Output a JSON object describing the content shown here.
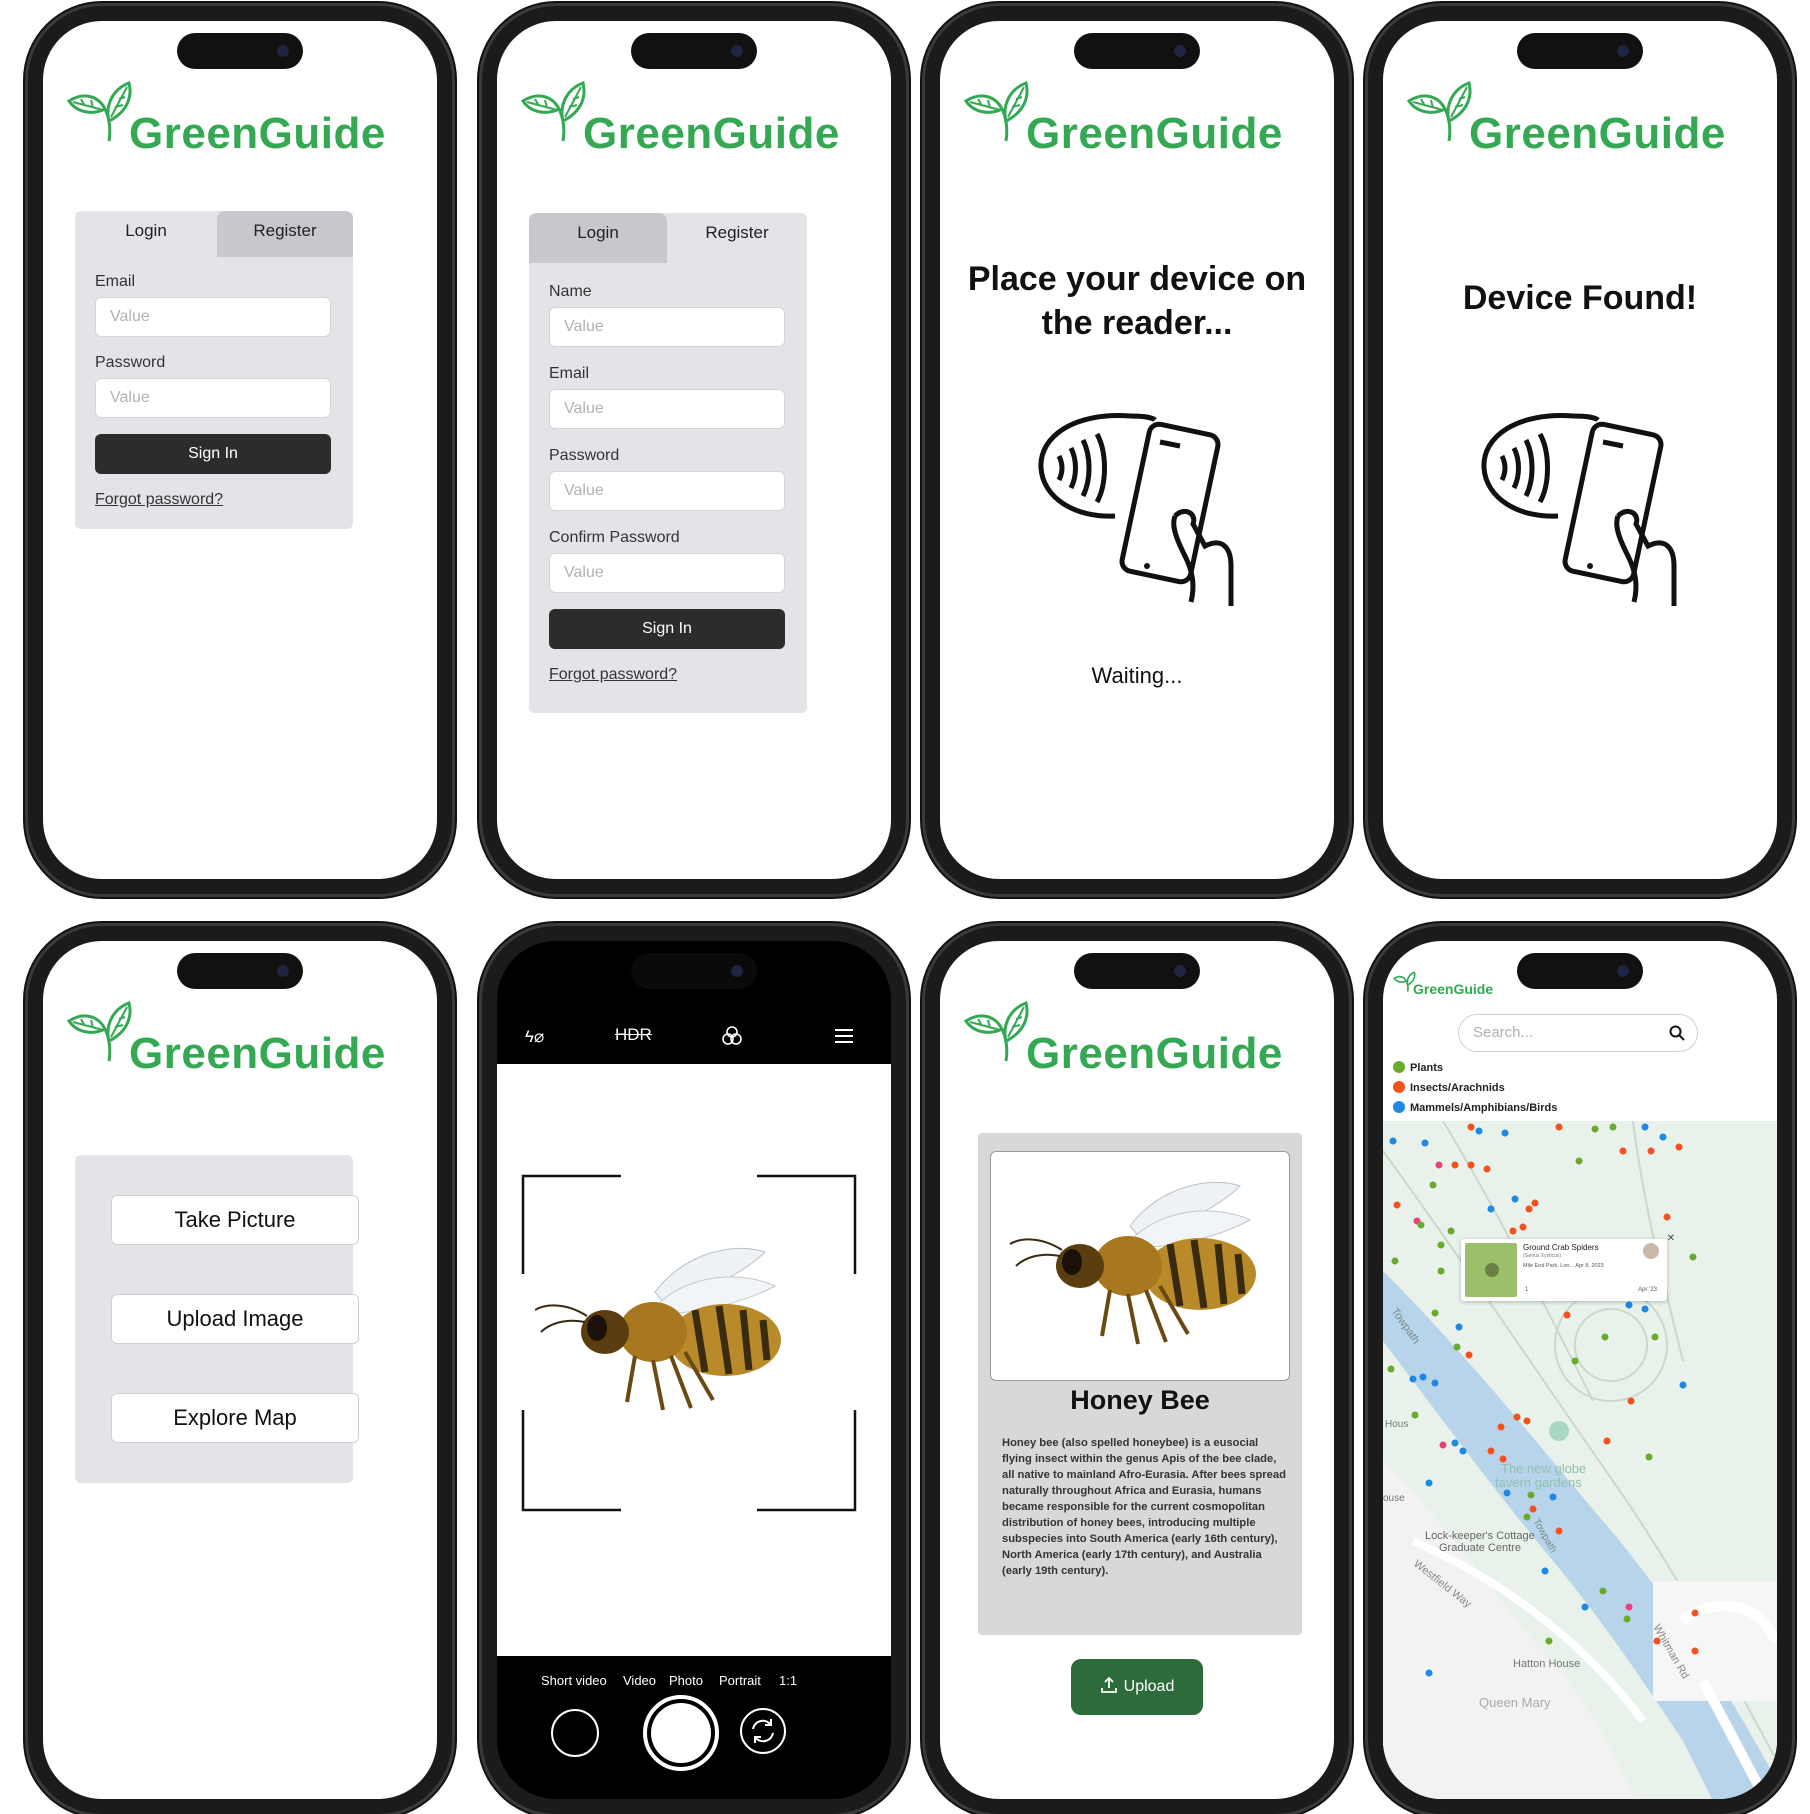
{
  "app": {
    "brand": "GreenGuide"
  },
  "login_screen": {
    "tabs": [
      "Login",
      "Register"
    ],
    "email_label": "Email",
    "email_placeholder": "Value",
    "password_label": "Password",
    "password_placeholder": "Value",
    "signin_label": "Sign In",
    "forgot_label": "Forgot password?"
  },
  "register_screen": {
    "tabs": [
      "Login",
      "Register"
    ],
    "name_label": "Name",
    "email_label": "Email",
    "password_label": "Password",
    "confirm_label": "Confirm Password",
    "placeholder": "Value",
    "signin_label": "Sign In",
    "forgot_label": "Forgot password?"
  },
  "nfc_waiting": {
    "title": "Place your device on the reader...",
    "status": "Waiting..."
  },
  "nfc_found": {
    "title": "Device Found!"
  },
  "menu_screen": {
    "take_picture": "Take Picture",
    "upload_image": "Upload Image",
    "explore_map": "Explore Map"
  },
  "camera_screen": {
    "top_icons": [
      "flash-off-icon",
      "hdr-icon",
      "filters-icon",
      "menu-icon"
    ],
    "hdr_label": "HDR",
    "modes": [
      "Short video",
      "Video",
      "Photo",
      "Portrait",
      "1:1"
    ]
  },
  "result_screen": {
    "title": "Honey Bee",
    "description": "Honey bee (also spelled honeybee) is a eusocial flying insect within the genus Apis of the bee clade, all native to mainland Afro-Eurasia. After bees spread naturally throughout Africa and Eurasia, humans became responsible for the current cosmopolitan distribution of honey bees, introducing multiple subspecies into South America (early 16th century), North America (early 17th century), and Australia (early 19th century).",
    "upload_label": "Upload"
  },
  "map_screen": {
    "search_placeholder": "Search...",
    "legend": [
      {
        "label": "Plants",
        "color": "#6aab2e"
      },
      {
        "label": "Insects/Arachnids",
        "color": "#f4511e"
      },
      {
        "label": "Mammels/Amphibians/Birds",
        "color": "#1e88e5"
      }
    ],
    "popup": {
      "title": "Ground Crab Spiders",
      "subtitle": "(Genus Xysticus)",
      "meta": "Mile End Park, Lon... Apr 8, 2023",
      "count": "1",
      "date": "Apr '23"
    },
    "places": [
      "Towpath",
      "Hous",
      "ouse",
      "The new globe tavern gardens",
      "Towpath",
      "Lock-keeper's Cottage Graduate Centre",
      "Westfield Way",
      "Whitman Rd",
      "Hatton House",
      "Queen Mary"
    ]
  }
}
